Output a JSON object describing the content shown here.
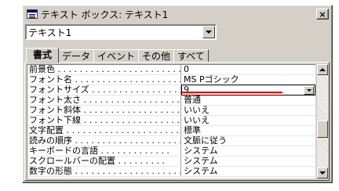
{
  "window": {
    "title": "テキスト ボックス: テキスト1",
    "close_label": "×"
  },
  "object_select": {
    "value": "テキスト1"
  },
  "tabs": [
    {
      "label": "書式",
      "active": true
    },
    {
      "label": "データ",
      "active": false
    },
    {
      "label": "イベント",
      "active": false
    },
    {
      "label": "その他",
      "active": false
    },
    {
      "label": "すべて",
      "active": false
    }
  ],
  "properties": [
    {
      "name": "前景色 . . . . . . . . . . . . . . . . . . . . . . . .",
      "value": "0"
    },
    {
      "name": "フォント名 . . . . . . . . . . . . . . . . . . . . .",
      "value": "MS Pゴシック"
    },
    {
      "name": "フォントサイズ . . . . . . . . . . . . . . . . .",
      "value": "9"
    },
    {
      "name": "フォント太さ . . . . . . . . . . . . . . . . . . .",
      "value": "普通"
    },
    {
      "name": "フォント斜体 . . . . . . . . . . . . . . . . . .",
      "value": "いいえ"
    },
    {
      "name": "フォント下線 . . . . . . . . . . . . . . . . . .",
      "value": "いいえ"
    },
    {
      "name": "文字配置 . . . . . . . . . . . . . . . . . . . . . .",
      "value": "標準"
    },
    {
      "name": "読みの順序 . . . . . . . . . . . . . . . . . . . .",
      "value": "文脈に従う"
    },
    {
      "name": "キーボードの言語 . . . . . . . . . . . . .",
      "value": "システム"
    },
    {
      "name": "スクロールバーの配置 . . . . . . . . .",
      "value": "システム"
    },
    {
      "name": "数字の形態 . . . . . . . . . . . . . . . . . . . .",
      "value": "システム"
    }
  ],
  "selected_property_index": 2,
  "scrollbar": {
    "position": 0.6
  }
}
